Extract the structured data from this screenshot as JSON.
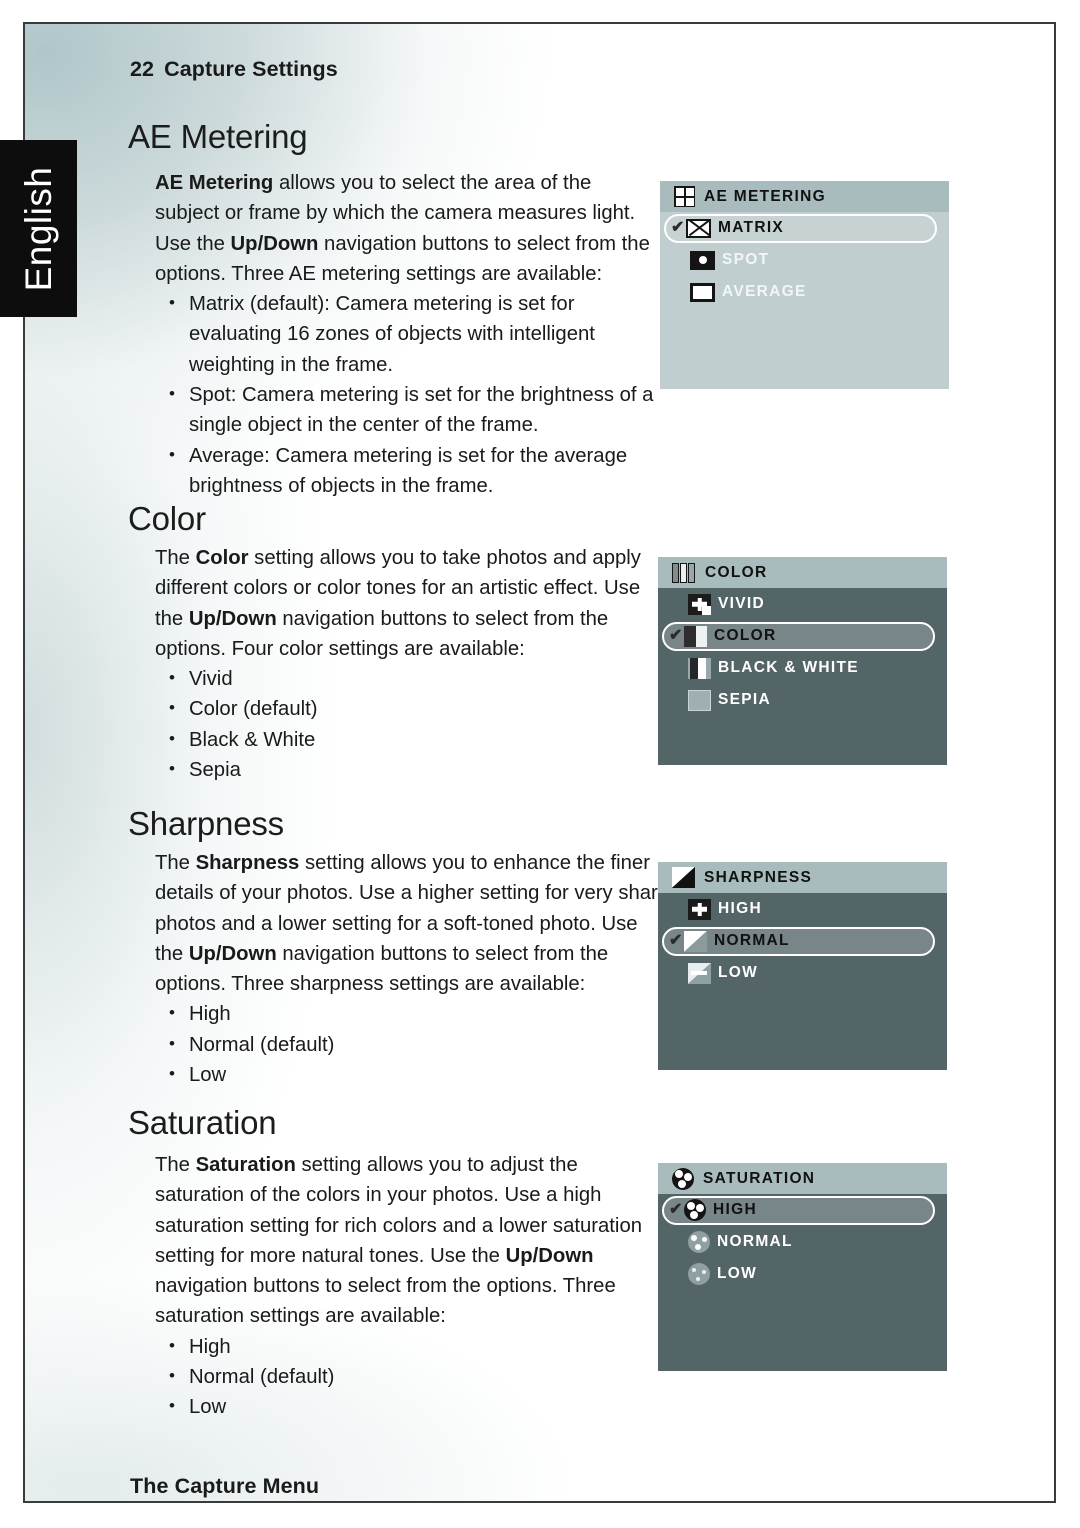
{
  "page": {
    "running_head_number": "22",
    "running_head_title": "Capture Settings",
    "language_tab": "English",
    "footer": "The Capture Menu"
  },
  "sections": [
    {
      "heading": "AE Metering",
      "paragraph_parts": [
        {
          "text": "AE Metering",
          "bold": true
        },
        {
          "text": " allows you to select the area of the subject or frame by which the camera measures light. Use the ",
          "bold": false
        },
        {
          "text": "Up/Down",
          "bold": true
        },
        {
          "text": " navigation buttons to select from the options. Three AE metering settings are available:",
          "bold": false
        }
      ],
      "bullets": [
        "Matrix (default): Camera metering is set for evaluating 16 zones of objects with intelligent weighting in the frame.",
        "Spot: Camera metering is set for the brightness of a single object in the center of the frame.",
        "Average: Camera metering is set for the average brightness of objects in the frame."
      ],
      "menu": {
        "theme": "light",
        "title": "AE METERING",
        "header_icon": "grid-2x2-icon",
        "checkmark": "✔",
        "items": [
          {
            "label": "MATRIX",
            "icon": "matrix-icon",
            "selected": true
          },
          {
            "label": "SPOT",
            "icon": "spot-icon",
            "selected": false
          },
          {
            "label": "AVERAGE",
            "icon": "average-icon",
            "selected": false
          }
        ]
      }
    },
    {
      "heading": "Color",
      "paragraph_parts": [
        {
          "text": "The ",
          "bold": false
        },
        {
          "text": "Color",
          "bold": true
        },
        {
          "text": " setting allows you to take photos and apply different colors or color tones for an artistic effect. Use the ",
          "bold": false
        },
        {
          "text": "Up/Down",
          "bold": true
        },
        {
          "text": " navigation buttons to select from the options. Four color settings are available:",
          "bold": false
        }
      ],
      "bullets": [
        "Vivid",
        "Color (default)",
        "Black & White",
        "Sepia"
      ],
      "menu": {
        "theme": "dark",
        "title": "COLOR",
        "header_icon": "color-cards-icon",
        "checkmark": "✔",
        "items": [
          {
            "label": "VIVID",
            "icon": "vivid-plus-icon",
            "selected": false
          },
          {
            "label": "COLOR",
            "icon": "color-half-icon",
            "selected": true
          },
          {
            "label": "BLACK & WHITE",
            "icon": "black-white-icon",
            "selected": false
          },
          {
            "label": "SEPIA",
            "icon": "sepia-icon",
            "selected": false
          }
        ]
      }
    },
    {
      "heading": "Sharpness",
      "paragraph_parts": [
        {
          "text": "The ",
          "bold": false
        },
        {
          "text": "Sharpness",
          "bold": true
        },
        {
          "text": " setting allows you to enhance the finer details of your photos. Use a higher setting for very sharp photos and a lower setting for a soft-toned photo. Use the ",
          "bold": false
        },
        {
          "text": "Up/Down",
          "bold": true
        },
        {
          "text": " navigation buttons to select from the options. Three sharpness settings are available:",
          "bold": false
        }
      ],
      "bullets": [
        "High",
        "Normal (default)",
        "Low"
      ],
      "menu": {
        "theme": "dark",
        "title": "SHARPNESS",
        "header_icon": "sharpness-diagonal-icon",
        "checkmark": "✔",
        "items": [
          {
            "label": "HIGH",
            "icon": "sharpness-high-icon",
            "selected": false
          },
          {
            "label": "NORMAL",
            "icon": "sharpness-normal-icon",
            "selected": true
          },
          {
            "label": "LOW",
            "icon": "sharpness-low-icon",
            "selected": false
          }
        ]
      }
    },
    {
      "heading": "Saturation",
      "paragraph_parts": [
        {
          "text": "The ",
          "bold": false
        },
        {
          "text": "Saturation",
          "bold": true
        },
        {
          "text": " setting allows you to adjust the saturation of the colors in your photos. Use a high saturation setting for rich colors and a lower saturation setting for more natural tones. Use the ",
          "bold": false
        },
        {
          "text": "Up/Down",
          "bold": true
        },
        {
          "text": " navigation buttons to select from the options. Three saturation settings are available:",
          "bold": false
        }
      ],
      "bullets": [
        "High",
        "Normal (default)",
        "Low"
      ],
      "menu": {
        "theme": "dark",
        "title": "SATURATION",
        "header_icon": "saturation-high-icon",
        "checkmark": "✔",
        "items": [
          {
            "label": "HIGH",
            "icon": "saturation-high-icon",
            "selected": true
          },
          {
            "label": "NORMAL",
            "icon": "saturation-normal-icon",
            "selected": false
          },
          {
            "label": "LOW",
            "icon": "saturation-low-icon",
            "selected": false
          }
        ]
      }
    }
  ]
}
